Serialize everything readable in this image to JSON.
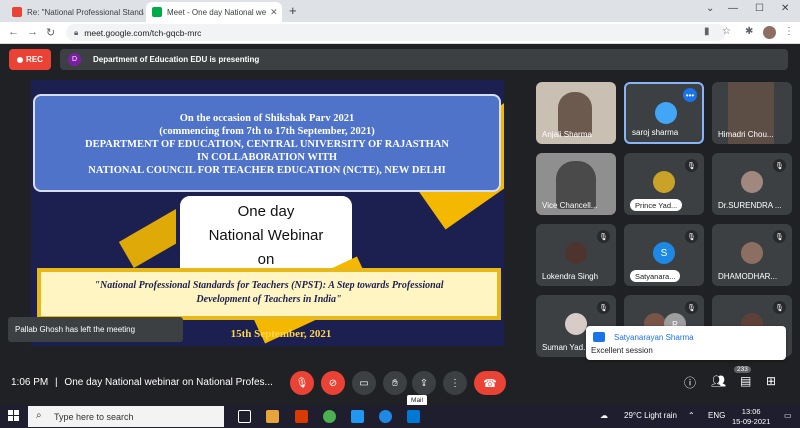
{
  "browser": {
    "tabs": [
      {
        "title": "Re: \"National Professional Standa",
        "favicon": "gmail-icon"
      },
      {
        "title": "Meet - One day National we",
        "favicon": "meet-icon",
        "active": true
      }
    ],
    "new_tab": "+",
    "url": "meet.google.com/tch-gqcb-mrc"
  },
  "meet": {
    "rec_label": "REC",
    "presenter_initial": "D",
    "presenting_text": "Department of Education EDU is presenting",
    "toast": "Pallab Ghosh has left the meeting",
    "time": "1:06 PM",
    "separator": "|",
    "meeting_title": "One day National webinar on National Profes...",
    "participant_count": "233",
    "tooltip": "Mail",
    "accent": "#1a73e8",
    "danger": "#ea4335"
  },
  "slide": {
    "line1": "On the occasion of  Shikshak Parv 2021",
    "line2": "(commencing from 7th to 17th September, 2021)",
    "line3": "DEPARTMENT OF EDUCATION, CENTRAL UNIVERSITY OF RAJASTHAN",
    "line4": "IN COLLABORATION WITH",
    "line5": "NATIONAL COUNCIL FOR TEACHER EDUCATION (NCTE), NEW DELHI",
    "mid1": "One day",
    "mid2": "National Webinar",
    "mid3": "on",
    "topic1": "\"National Professional Standards for Teachers (NPST): A Step towards Professional",
    "topic2": "Development of Teachers in India\"",
    "date": "15th September, 2021"
  },
  "participants": [
    {
      "name": "Anjali Sharma"
    },
    {
      "name": "saroj sharma"
    },
    {
      "name": "Himadri Chou..."
    },
    {
      "name": "Vice Chancell..."
    },
    {
      "name": "Prince Yad..."
    },
    {
      "name": "Dr.SURENDRA ..."
    },
    {
      "name": "Lokendra Singh"
    },
    {
      "name": "Satyanara...",
      "initial": "S"
    },
    {
      "name": "DHAMODHAR..."
    },
    {
      "name": "Suman Yad..."
    },
    {
      "name": "",
      "initial": "R"
    },
    {
      "name": ""
    }
  ],
  "notification": {
    "sender": "Satyanarayan Sharma",
    "message": "Excellent session"
  },
  "taskbar": {
    "search_placeholder": "Type here to search",
    "weather": "29°C  Light rain",
    "lang": "ENG",
    "time": "13:06",
    "date": "15-09-2021"
  }
}
